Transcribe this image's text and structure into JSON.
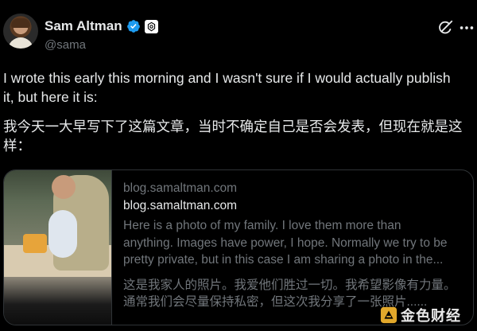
{
  "author": {
    "name": "Sam Altman",
    "handle": "@sama",
    "verified": true,
    "verified_color": "#1d9bf0"
  },
  "tweet": {
    "text_en": "I wrote this early this morning and I wasn't sure if I would actually publish\nit, but here it is:",
    "text_cn": "我今天一大早写下了这篇文章，当时不确定自己是否会发表，但现在就是这\n样："
  },
  "card": {
    "domain": "blog.samaltman.com",
    "title": "blog.samaltman.com",
    "description": "Here is a photo of my family. I love them more than\nanything. Images have power, I hope. Normally we try to be\npretty private, but in this case I am sharing a photo in the...",
    "description_cn": "这是我家人的照片。我爱他们胜过一切。我希望影像有力量。\n通常我们会尽量保持私密，但这次我分享了一张照片......"
  },
  "icons": {
    "grok": "grok-icon",
    "more": "more-icon",
    "affiliation": "openai-icon"
  },
  "watermark": {
    "text": "金色财经",
    "color": "#e2a82b"
  }
}
